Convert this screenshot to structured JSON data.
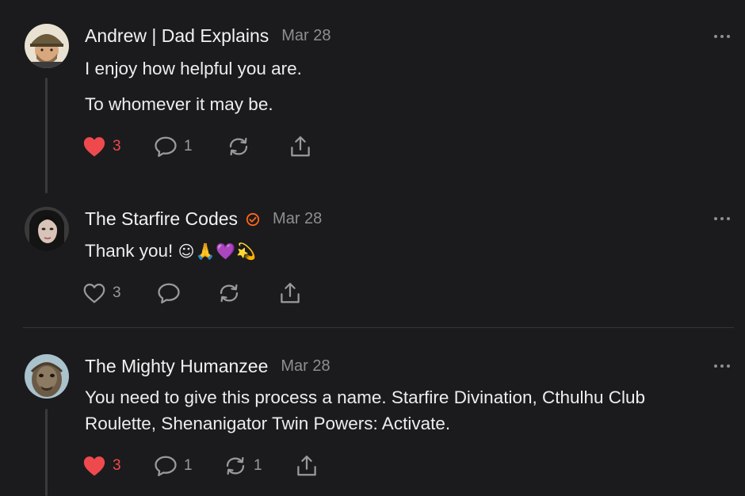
{
  "posts": [
    {
      "author": "Andrew | Dad Explains",
      "date": "Mar 28",
      "verified": false,
      "paragraphs": [
        "I enjoy how helpful you are.",
        "To whomever it may be."
      ],
      "likes": "3",
      "liked": true,
      "comments": "1",
      "restacks": ""
    },
    {
      "author": "The Starfire Codes",
      "date": "Mar 28",
      "verified": true,
      "text": "Thank you!",
      "emojis": "☺🙏💜💫",
      "likes": "3",
      "liked": false,
      "comments": "",
      "restacks": ""
    },
    {
      "author": "The Mighty Humanzee",
      "date": "Mar 28",
      "verified": false,
      "lines": [
        "You need to give this process a name. Starfire Divination, Cthulhu Club",
        "Roulette, Shenanigator Twin Powers: Activate."
      ],
      "likes": "3",
      "liked": true,
      "comments": "1",
      "restacks": "1"
    }
  ],
  "icons": {
    "heart": "heart-icon",
    "comment": "comment-icon",
    "restack": "restack-icon",
    "share": "share-icon",
    "more": "more-icon",
    "verified": "verified-badge-icon"
  },
  "colors": {
    "background": "#1b1b1d",
    "like_active": "#ee4a4e",
    "muted": "#8e8e92",
    "verified": "#ff6719"
  }
}
